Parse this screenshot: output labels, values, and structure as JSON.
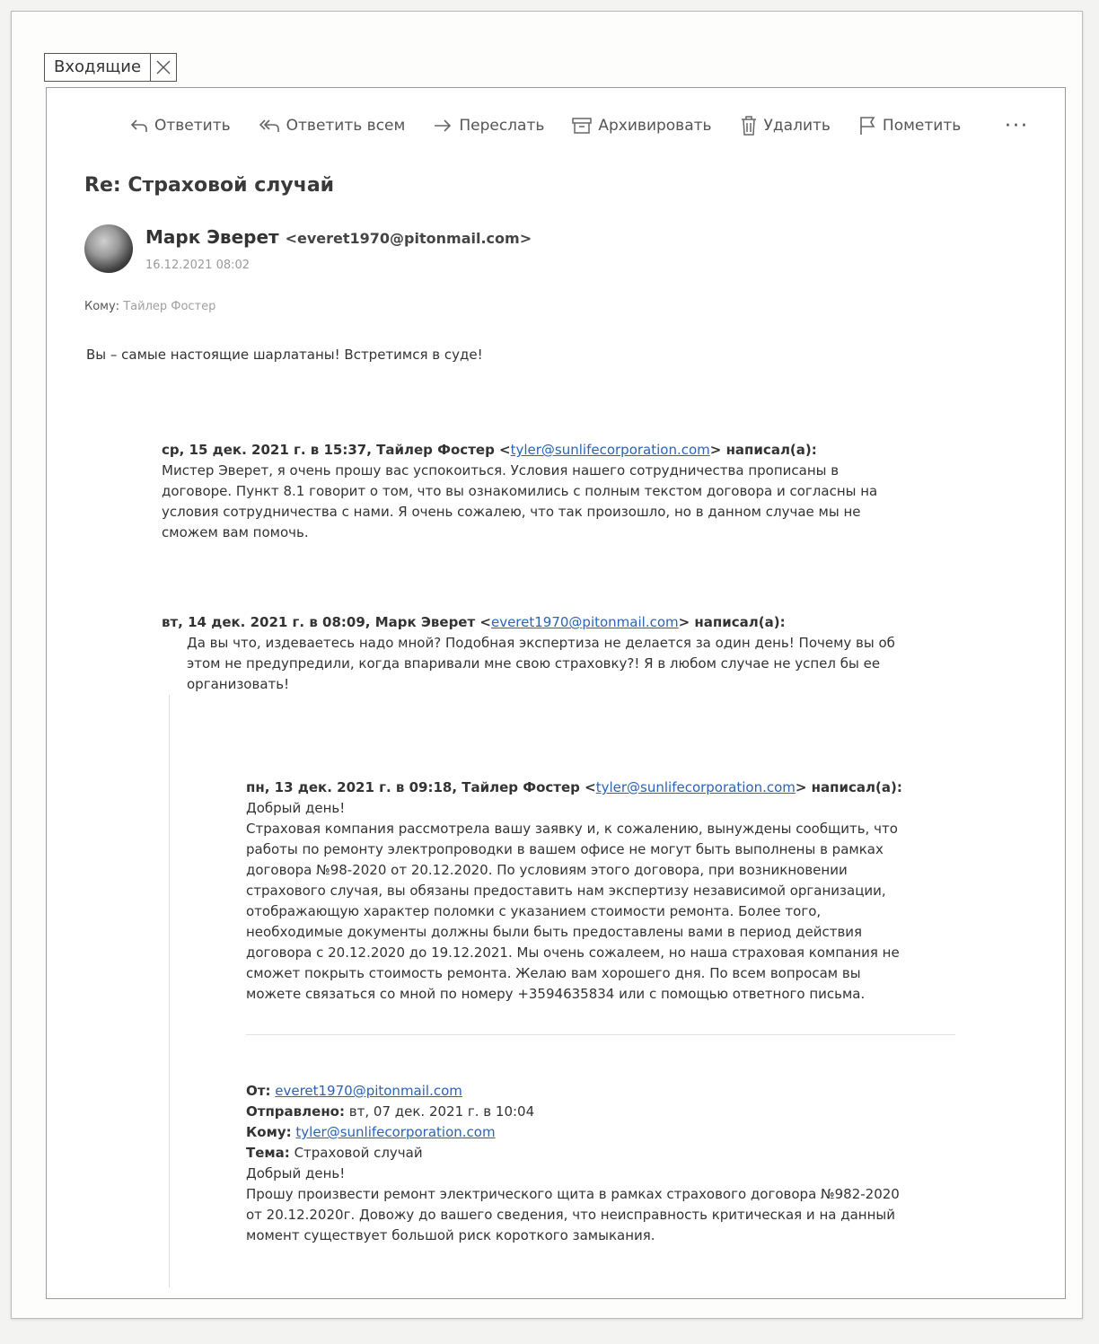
{
  "tab": {
    "label": "Входящие"
  },
  "toolbar": {
    "reply": "Ответить",
    "reply_all": "Ответить всем",
    "forward": "Переслать",
    "archive": "Архивировать",
    "delete": "Удалить",
    "flag": "Пометить",
    "more": "···"
  },
  "message": {
    "subject": "Re: Страховой случай",
    "sender_name": "Марк Эверет",
    "sender_email": "<everet1970@pitonmail.com>",
    "date": "16.12.2021  08:02",
    "to_label": "Кому:",
    "to_name": "Тайлер Фостер",
    "body": "Вы – самые настоящие шарлатаны! Встретимся в суде!"
  },
  "quote1": {
    "header_pre": "ср, 15 дек. 2021 г. в 15:37, Тайлер Фостер <",
    "email": "tyler@sunlifecorporation.com",
    "header_post": "> написал(а):",
    "lines": [
      "Мистер Эверет, я очень прошу вас успокоиться. Условия нашего сотрудничества прописаны в",
      "договоре. Пункт 8.1 говорит о том, что вы ознакомились с полным текстом договора и согласны на",
      "условия сотрудничества с нами. Я очень сожалею, что так произошло, но в данном случае мы не",
      "сможем вам помочь."
    ]
  },
  "quote2": {
    "header_pre": "вт, 14 дек. 2021 г. в 08:09, Марк Эверет <",
    "email": "everet1970@pitonmail.com",
    "header_post": "> написал(а):",
    "lines": [
      "Да вы что, издеваетесь надо мной? Подобная экспертиза не делается за один день! Почему вы об",
      "этом не предупредили, когда впаривали мне свою страховку?! Я в любом случае не успел бы ее",
      "организовать!"
    ]
  },
  "quote3": {
    "header_pre": "пн, 13 дек. 2021 г. в 09:18, Тайлер Фостер <",
    "email": "tyler@sunlifecorporation.com",
    "header_post": "> написал(а):",
    "lines": [
      "Добрый день!",
      "Страховая компания рассмотрела вашу заявку и, к сожалению, вынуждены сообщить, что",
      "работы по ремонту электропроводки в вашем офисе не могут быть выполнены в рамках",
      "договора №98-2020 от 20.12.2020. По условиям этого договора, при возникновении",
      "страхового случая,  вы обязаны предоставить нам экспертизу независимой организации,",
      "отображающую характер поломки с указанием стоимости ремонта. Более того,",
      "необходимые документы должны были быть предоставлены вами в период действия",
      "договора с 20.12.2020 до 19.12.2021. Мы очень сожалеем, но наша страховая компания не",
      "сможет покрыть стоимость ремонта. Желаю вам хорошего дня. По всем вопросам вы",
      "можете связаться со мной по номеру +3594635834 или с помощью ответного письма."
    ]
  },
  "original": {
    "from_label": "От:",
    "from_email": "everet1970@pitonmail.com",
    "sent_label": "Отправлено:",
    "sent_value": "вт, 07 дек. 2021 г. в 10:04",
    "to_label": "Кому:",
    "to_email": "tyler@sunlifecorporation.com",
    "subject_label": "Тема:",
    "subject_value": "Страховой случай",
    "lines": [
      "Добрый день!",
      "Прошу произвести ремонт электрического щита в рамках страхового договора №982-2020",
      "от 20.12.2020г. Довожу до вашего сведения, что неисправность критическая и на данный",
      "момент существует большой риск короткого замыкания."
    ]
  }
}
